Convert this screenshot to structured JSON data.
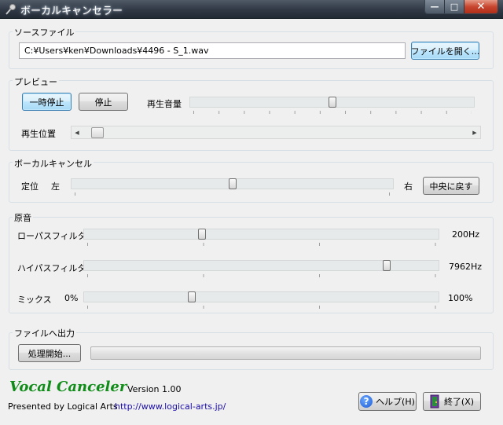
{
  "window": {
    "title": "ボーカルキャンセラー",
    "minimize": "—",
    "maximize": "□",
    "close": "✕"
  },
  "source": {
    "group_label": "ソースファイル",
    "path": "C:¥Users¥ken¥Downloads¥4496 - S_1.wav",
    "open_button": "ファイルを開く..."
  },
  "preview": {
    "group_label": "プレビュー",
    "pause_button": "一時停止",
    "stop_button": "停止",
    "volume_label": "再生音量",
    "volume_level": 0.5,
    "position_label": "再生位置",
    "position_level": 0.02
  },
  "vocal_cancel": {
    "group_label": "ボーカルキャンセル",
    "position_label": "定位",
    "left_label": "左",
    "right_label": "右",
    "balance_level": 0.5,
    "center_button": "中央に戻す"
  },
  "original": {
    "group_label": "原音",
    "lowpass_label": "ローパスフィルタ",
    "lowpass_value": "200Hz",
    "lowpass_level": 0.33,
    "highpass_label": "ハイパスフィルタ",
    "highpass_value": "7962Hz",
    "highpass_level": 0.86,
    "mix_label": "ミックス",
    "mix_min": "0%",
    "mix_max": "100%",
    "mix_level": 0.3
  },
  "output": {
    "group_label": "ファイルへ出力",
    "process_button": "処理開始...",
    "progress": 0
  },
  "footer": {
    "app_name": "Vocal Canceler",
    "version": "Version 1.00",
    "presented_by": "Presented by Logical Arts",
    "url": "http://www.logical-arts.jp/",
    "help_button": "ヘルプ(H)",
    "exit_button": "終了(X)"
  }
}
